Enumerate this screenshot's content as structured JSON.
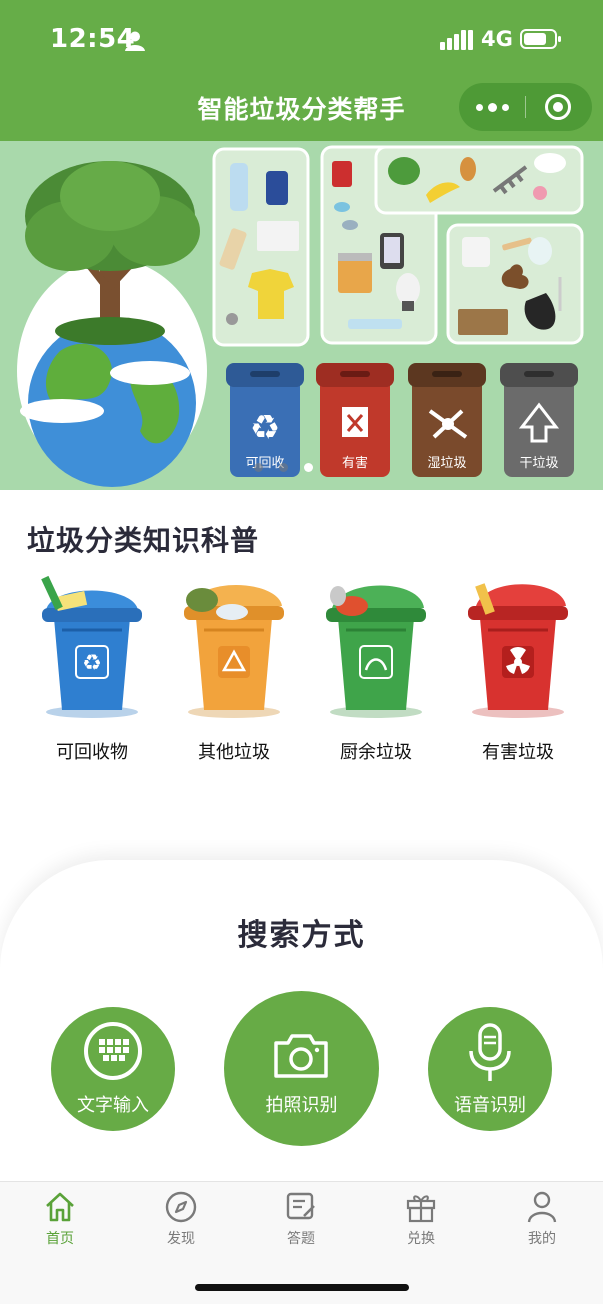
{
  "status_bar": {
    "time": "12:54",
    "network": "4G"
  },
  "nav": {
    "title": "智能垃圾分类帮手"
  },
  "banner": {
    "bins": [
      {
        "label": "可回收",
        "color": "#3a6fb5"
      },
      {
        "label": "有害",
        "color": "#c0392b"
      },
      {
        "label": "湿垃圾",
        "color": "#7a4a2c"
      },
      {
        "label": "干垃圾",
        "color": "#6b6b6b"
      }
    ],
    "slide_count": 3,
    "active_slide": 3
  },
  "knowledge": {
    "title": "垃圾分类知识科普",
    "categories": [
      {
        "label": "可回收物",
        "color": "#2f7fd0"
      },
      {
        "label": "其他垃圾",
        "color": "#f2a33c"
      },
      {
        "label": "厨余垃圾",
        "color": "#3fa44a"
      },
      {
        "label": "有害垃圾",
        "color": "#d8322f"
      }
    ]
  },
  "search": {
    "title": "搜索方式",
    "buttons": [
      {
        "label": "文字输入",
        "icon": "keyboard-icon"
      },
      {
        "label": "拍照识别",
        "icon": "camera-icon"
      },
      {
        "label": "语音识别",
        "icon": "microphone-icon"
      }
    ]
  },
  "tabbar": {
    "items": [
      {
        "label": "首页",
        "icon": "home-icon",
        "active": true
      },
      {
        "label": "发现",
        "icon": "compass-icon",
        "active": false
      },
      {
        "label": "答题",
        "icon": "quiz-icon",
        "active": false
      },
      {
        "label": "兑换",
        "icon": "gift-icon",
        "active": false
      },
      {
        "label": "我的",
        "icon": "profile-icon",
        "active": false
      }
    ]
  },
  "colors": {
    "primary": "#66ad48",
    "primary_dark": "#4e9a36",
    "tab_active": "#5aa239"
  }
}
